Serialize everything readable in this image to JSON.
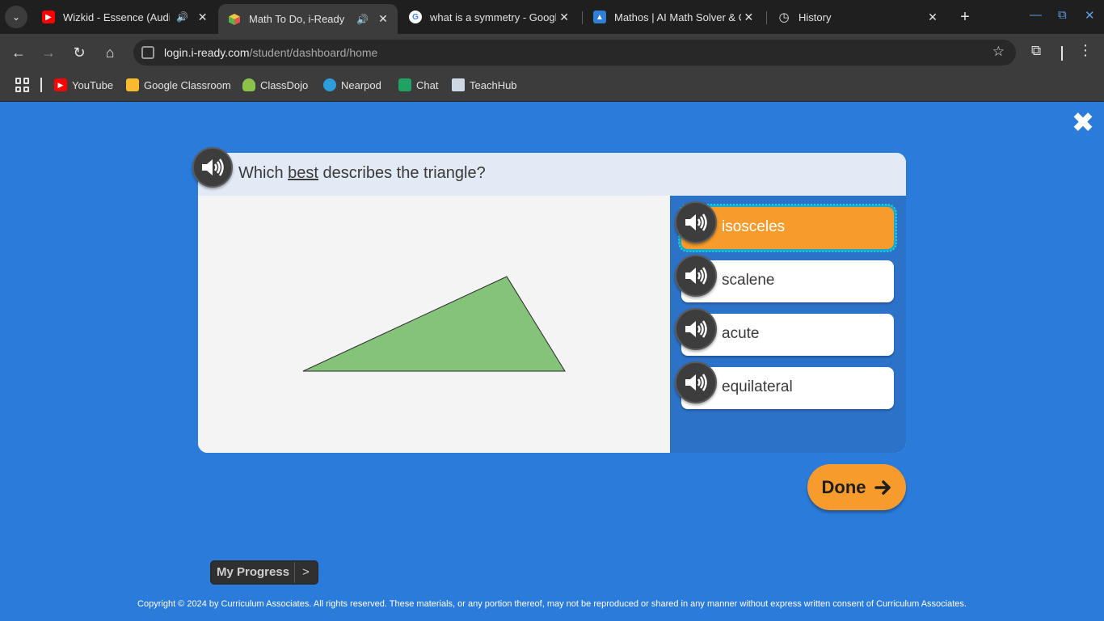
{
  "browser": {
    "tabs": [
      {
        "title": "Wizkid - Essence (Audio",
        "favicon": "youtube-icon",
        "favicon_color": "#ff0000",
        "speaker": true
      },
      {
        "title": "Math To Do, i-Ready",
        "favicon": "iready-cube-icon",
        "favicon_color": "#58b547",
        "speaker": true,
        "active": true
      },
      {
        "title": "what is a symmetry - Googl",
        "favicon": "google-icon",
        "favicon_color": "#ffffff",
        "speaker": false
      },
      {
        "title": "Mathos | AI Math Solver & C",
        "favicon": "mathos-icon",
        "favicon_color": "#2f7fd8",
        "speaker": false
      },
      {
        "title": "History",
        "favicon": "history-icon",
        "favicon_color": "#e3e3e3",
        "speaker": false
      }
    ],
    "url": {
      "host": "login.i-ready.com",
      "path": "/student/dashboard/home"
    },
    "bookmarks": [
      {
        "label": "YouTube",
        "icon": "youtube-icon",
        "color": "#ff0000"
      },
      {
        "label": "Google Classroom",
        "icon": "google-classroom-icon",
        "color": "#f9bb2d"
      },
      {
        "label": "ClassDojo",
        "icon": "classdojo-icon",
        "color": "#8bc34a"
      },
      {
        "label": "Nearpod",
        "icon": "nearpod-icon",
        "color": "#2d9cdb"
      },
      {
        "label": "Chat",
        "icon": "google-chat-icon",
        "color": "#1ea362"
      },
      {
        "label": "TeachHub",
        "icon": "teachhub-icon",
        "color": "#cfd8e6"
      }
    ]
  },
  "question": {
    "prefix": "Which ",
    "emphasis": "best",
    "suffix": " describes the triangle?"
  },
  "answers": [
    {
      "label": "isosceles",
      "selected": true
    },
    {
      "label": "scalene",
      "selected": false
    },
    {
      "label": "acute",
      "selected": false
    },
    {
      "label": "equilateral",
      "selected": false
    }
  ],
  "done_label": "Done",
  "my_progress": {
    "label": "My Progress",
    "arrow": ">"
  },
  "copyright": "Copyright © 2024 by Curriculum Associates. All rights reserved. These materials, or any portion thereof, may not be reproduced or shared in any manner without express written consent of Curriculum Associates.",
  "colors": {
    "page_bg": "#2b7bdb",
    "triangle_fill": "#85c27a",
    "selected_answer": "#f79c2c",
    "done_button": "#f79c2c"
  }
}
